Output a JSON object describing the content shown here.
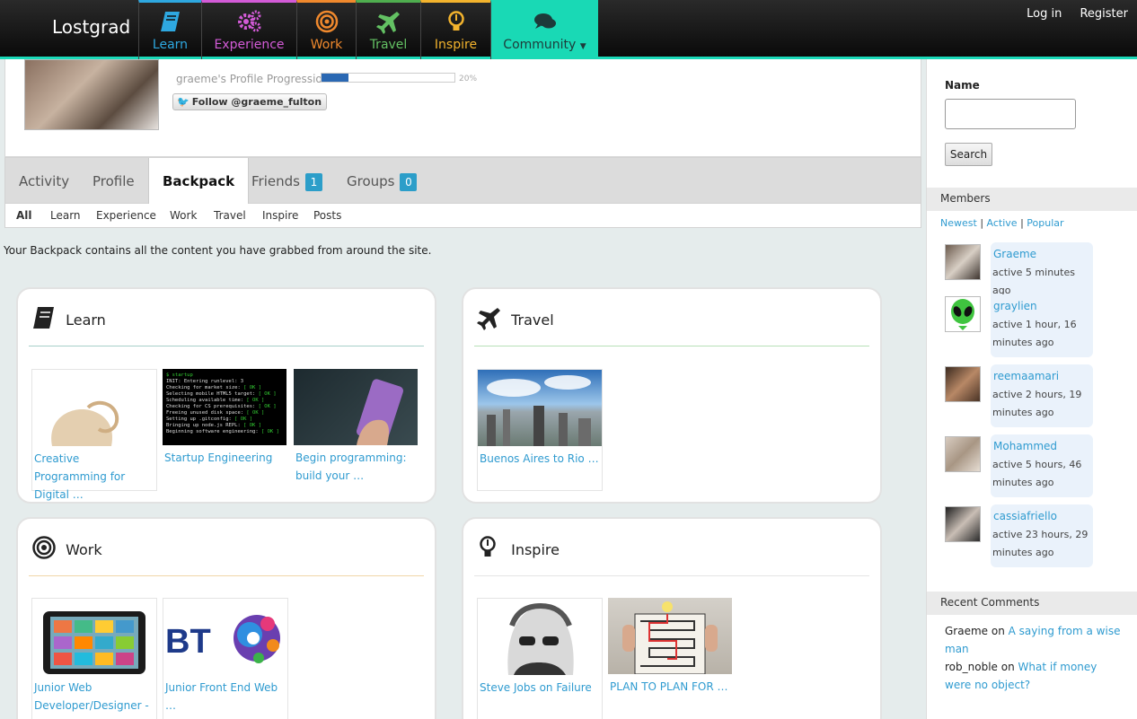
{
  "brand": "Lostgrad",
  "nav": [
    {
      "label": "Learn",
      "color": "#2ea8e0"
    },
    {
      "label": "Experience",
      "color": "#d35bd7"
    },
    {
      "label": "Work",
      "color": "#f0892d"
    },
    {
      "label": "Travel",
      "color": "#63c163"
    },
    {
      "label": "Inspire",
      "color": "#f3b32d"
    },
    {
      "label": "Community",
      "color": "#19d9b5"
    }
  ],
  "top_links": {
    "login": "Log in",
    "register": "Register"
  },
  "profile": {
    "progress_label": "graeme's Profile Progression",
    "progress_pct": 0.2,
    "progress_text": "20%",
    "follow_label": "Follow @graeme_fulton"
  },
  "tabs": [
    {
      "label": "Activity"
    },
    {
      "label": "Profile"
    },
    {
      "label": "Backpack",
      "active": true
    },
    {
      "label": "Friends",
      "count": "1"
    },
    {
      "label": "Groups",
      "count": "0"
    }
  ],
  "subtabs": [
    "All",
    "Learn",
    "Experience",
    "Work",
    "Travel",
    "Inspire",
    "Posts"
  ],
  "intro": "Your Backpack contains all the content you have grabbed from around the site.",
  "sections": {
    "learn": {
      "title": "Learn",
      "items": [
        "Creative Programming for Digital …",
        "Startup Engineering",
        "Begin programming: build your …"
      ]
    },
    "travel": {
      "title": "Travel",
      "items": [
        "Buenos Aires to Rio …"
      ]
    },
    "work": {
      "title": "Work",
      "items": [
        "Junior Web Developer/Designer -",
        "Junior Front End Web …"
      ]
    },
    "inspire": {
      "title": "Inspire",
      "items": [
        "Steve Jobs on Failure",
        "PLAN TO PLAN FOR …"
      ]
    }
  },
  "sidebar": {
    "name_label": "Name",
    "search_button": "Search",
    "members_heading": "Members",
    "filter": {
      "newest": "Newest",
      "active": "Active",
      "popular": "Popular",
      "sep": "|"
    },
    "members": [
      {
        "name": "Graeme",
        "activity": "active 5 minutes ago"
      },
      {
        "name": "graylien",
        "activity": "active 1 hour, 16 minutes ago"
      },
      {
        "name": "reemaamari",
        "activity": "active 2 hours, 19 minutes ago"
      },
      {
        "name": "Mohammed",
        "activity": "active 5 hours, 46 minutes ago"
      },
      {
        "name": "cassiafriello",
        "activity": "active 23 hours, 29 minutes ago"
      }
    ],
    "comments_heading": "Recent Comments",
    "comments": [
      {
        "author": "Graeme",
        "on": "on",
        "title": "A saying from a wise man"
      },
      {
        "author": "rob_noble",
        "on": "on",
        "title": "What if money were no object?"
      }
    ]
  }
}
